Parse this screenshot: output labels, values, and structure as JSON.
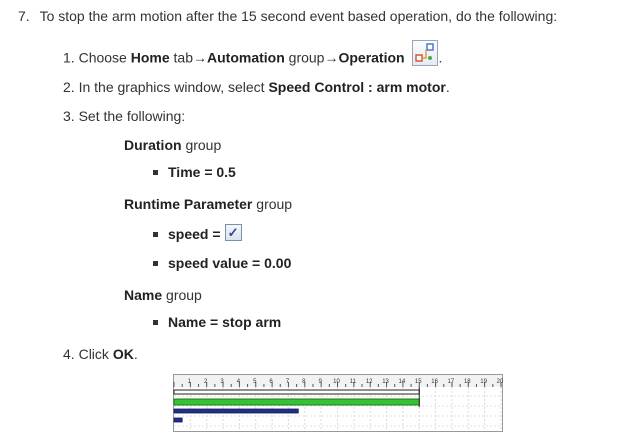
{
  "step7": {
    "number": "7.",
    "text": "To stop the arm motion after the 15 second event based operation, do the following:"
  },
  "sub1": {
    "number": "1.",
    "prefix": "Choose ",
    "home": "Home",
    "tab": " tab",
    "arrow1": "→",
    "automation": "Automation",
    "group": " group",
    "arrow2": "→",
    "operation": "Operation",
    "icon": "operation-icon"
  },
  "sub2": {
    "number": "2.",
    "prefix": "In the graphics window, select ",
    "bold": "Speed Control : arm motor",
    "suffix": "."
  },
  "sub3": {
    "number": "3.",
    "text": "Set the following:"
  },
  "duration": {
    "group_bold": "Duration",
    "group_suffix": " group",
    "item": "Time = 0.5"
  },
  "runtime": {
    "group_bold": "Runtime Parameter",
    "group_suffix": " group",
    "speed_label": "speed =",
    "speed_checked_glyph": "✓",
    "speed_value": "speed value = 0.00"
  },
  "name_group": {
    "group_bold": "Name",
    "group_suffix": " group",
    "item": "Name = stop arm"
  },
  "sub4": {
    "number": "4.",
    "prefix": "Click ",
    "bold": "OK",
    "suffix": "."
  },
  "timeline": {
    "ticks": [
      "1",
      "2",
      "3",
      "4",
      "5",
      "6",
      "7",
      "8",
      "9",
      "10",
      "11",
      "12",
      "13",
      "14",
      "15",
      "16",
      "17",
      "18",
      "19",
      "20"
    ],
    "max": 20,
    "bars": [
      {
        "start": 0,
        "end": 15,
        "color": "#222222"
      },
      {
        "start": 0,
        "end": 15,
        "color": "#35c235"
      },
      {
        "start": 0,
        "end": 7.6,
        "color": "#1f2f8a"
      },
      {
        "start": 0,
        "end": 0.5,
        "color": "#1f2f8a"
      }
    ]
  }
}
